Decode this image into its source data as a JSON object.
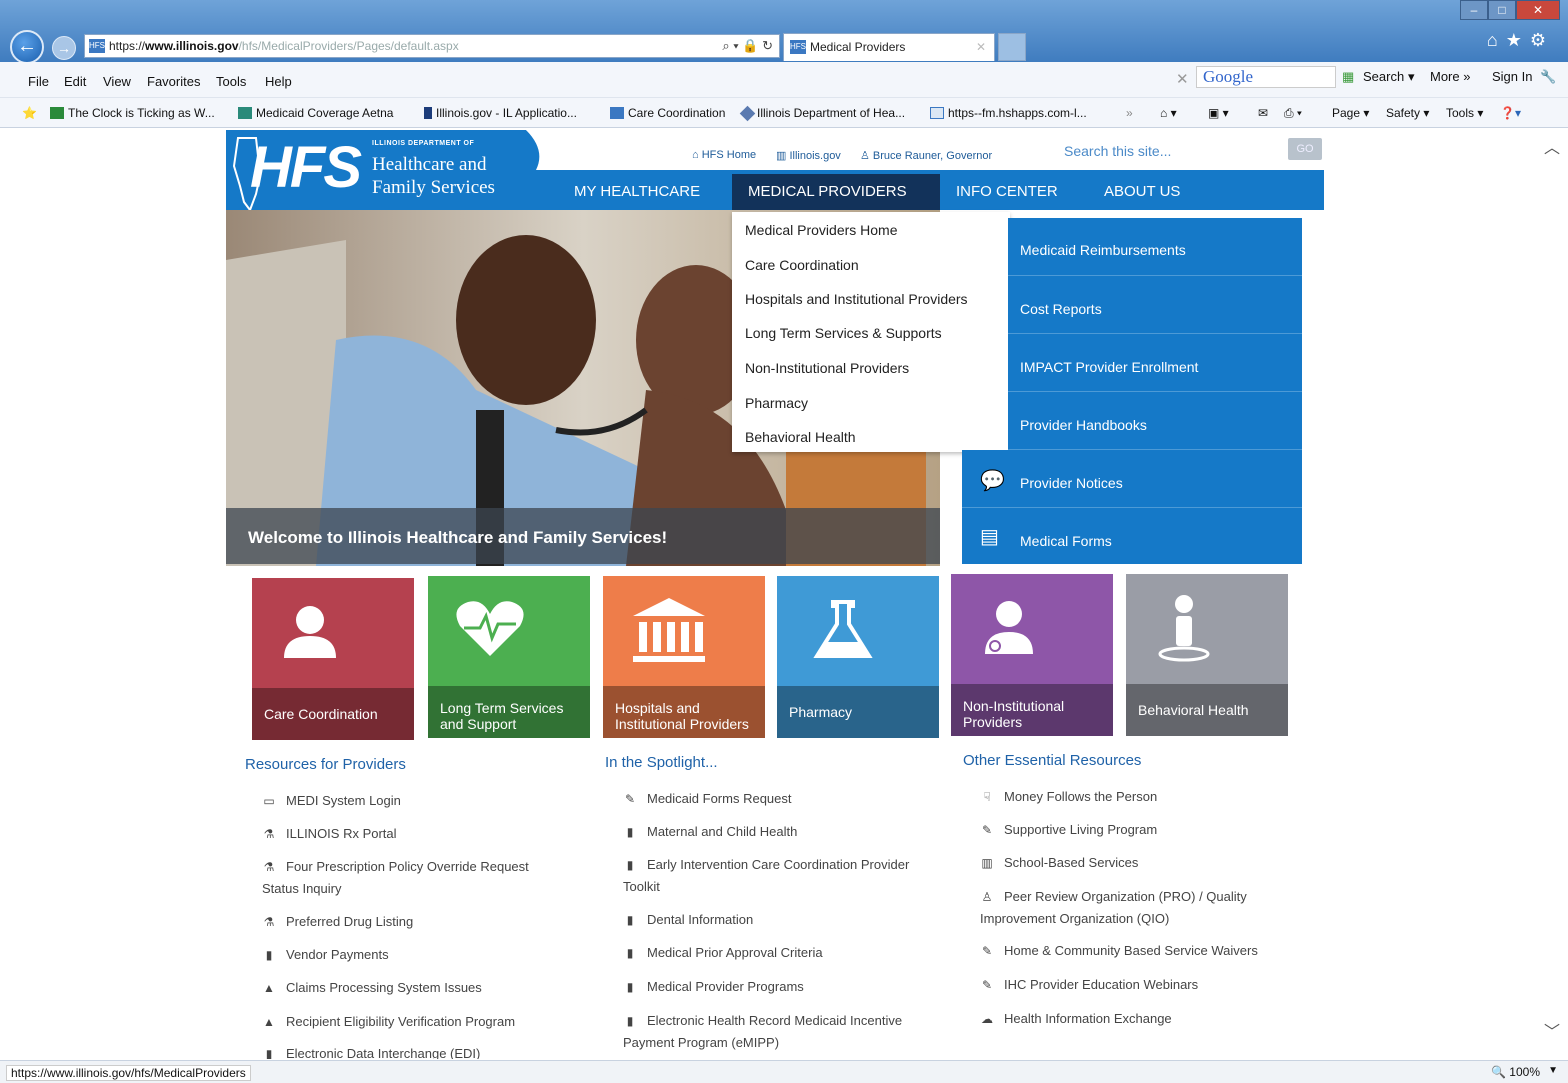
{
  "browser": {
    "address_proto": "https://",
    "address_domain": "www.illinois.gov",
    "address_path": "/hfs/MedicalProviders/Pages/default.aspx",
    "tab_title": "Medical Providers",
    "menu": [
      "File",
      "Edit",
      "View",
      "Favorites",
      "Tools",
      "Help"
    ],
    "google_label": "Google",
    "search_label": "Search",
    "more_label": "More",
    "signin_label": "Sign In",
    "favorites": [
      "The Clock is Ticking as W...",
      "Medicaid Coverage  Aetna",
      "Illinois.gov - IL Applicatio...",
      "Care Coordination",
      "Illinois Department of Hea...",
      "https--fm.hshapps.com-l..."
    ],
    "toolbar": {
      "page": "Page",
      "safety": "Safety",
      "tools": "Tools"
    },
    "status_url": "https://www.illinois.gov/hfs/MedicalProviders",
    "zoom": "100%"
  },
  "site": {
    "logo": {
      "dept": "ILLINOIS DEPARTMENT OF",
      "initials": "HFS",
      "line1": "Healthcare and",
      "line2": "Family Services"
    },
    "util_links": [
      "HFS Home",
      "Illinois.gov",
      "Bruce Rauner, Governor"
    ],
    "search_placeholder": "Search this site...",
    "go_label": "GO",
    "nav": [
      "MY HEALTHCARE",
      "MEDICAL PROVIDERS",
      "INFO CENTER",
      "ABOUT US"
    ],
    "dropdown": [
      "Medical Providers Home",
      "Care Coordination",
      "Hospitals and Institutional Providers",
      "Long Term Services & Supports",
      "Non-Institutional Providers",
      "Pharmacy",
      "Behavioral Health"
    ],
    "right_panel": [
      "Medicaid Reimbursements",
      "Cost Reports",
      "IMPACT Provider Enrollment",
      "Provider Handbooks",
      "Provider Notices",
      "Medical Forms"
    ],
    "hero_caption": "Welcome to Illinois Healthcare and Family Services!",
    "tiles": [
      {
        "label": "Care Coordination",
        "color": "#b5414f"
      },
      {
        "label": "Long Term Services and Support",
        "color": "#4caf50"
      },
      {
        "label": "Hospitals and Institutional Providers",
        "color": "#ee7d4a"
      },
      {
        "label": "Pharmacy",
        "color": "#3f9ad6"
      },
      {
        "label": "Non-Institutional Providers",
        "color": "#8e56a8"
      },
      {
        "label": "Behavioral Health",
        "color": "#9a9da6"
      }
    ],
    "resources": {
      "title": "Resources for Providers",
      "items": [
        "MEDI System Login",
        "ILLINOIS Rx Portal",
        "Four Prescription Policy Override Request Status Inquiry",
        "Preferred Drug Listing",
        "Vendor Payments",
        "Claims Processing System Issues",
        "Recipient Eligibility Verification Program",
        "Electronic Data Interchange (EDI)"
      ]
    },
    "spotlight": {
      "title": "In the Spotlight...",
      "items": [
        "Medicaid Forms Request",
        "Maternal and Child Health",
        "Early Intervention Care Coordination Provider Toolkit",
        "Dental Information",
        "Medical Prior Approval Criteria",
        "Medical Provider Programs",
        "Electronic Health Record Medicaid Incentive Payment Program (eMIPP)"
      ]
    },
    "other": {
      "title": "Other Essential Resources",
      "items": [
        "Money Follows the Person",
        "Supportive Living Program",
        "School-Based Services",
        "Peer Review Organization (PRO) / Quality Improvement Organization (QIO)",
        "Home & Community Based Service Waivers",
        "IHC Provider Education Webinars",
        "Health Information Exchange"
      ]
    }
  }
}
